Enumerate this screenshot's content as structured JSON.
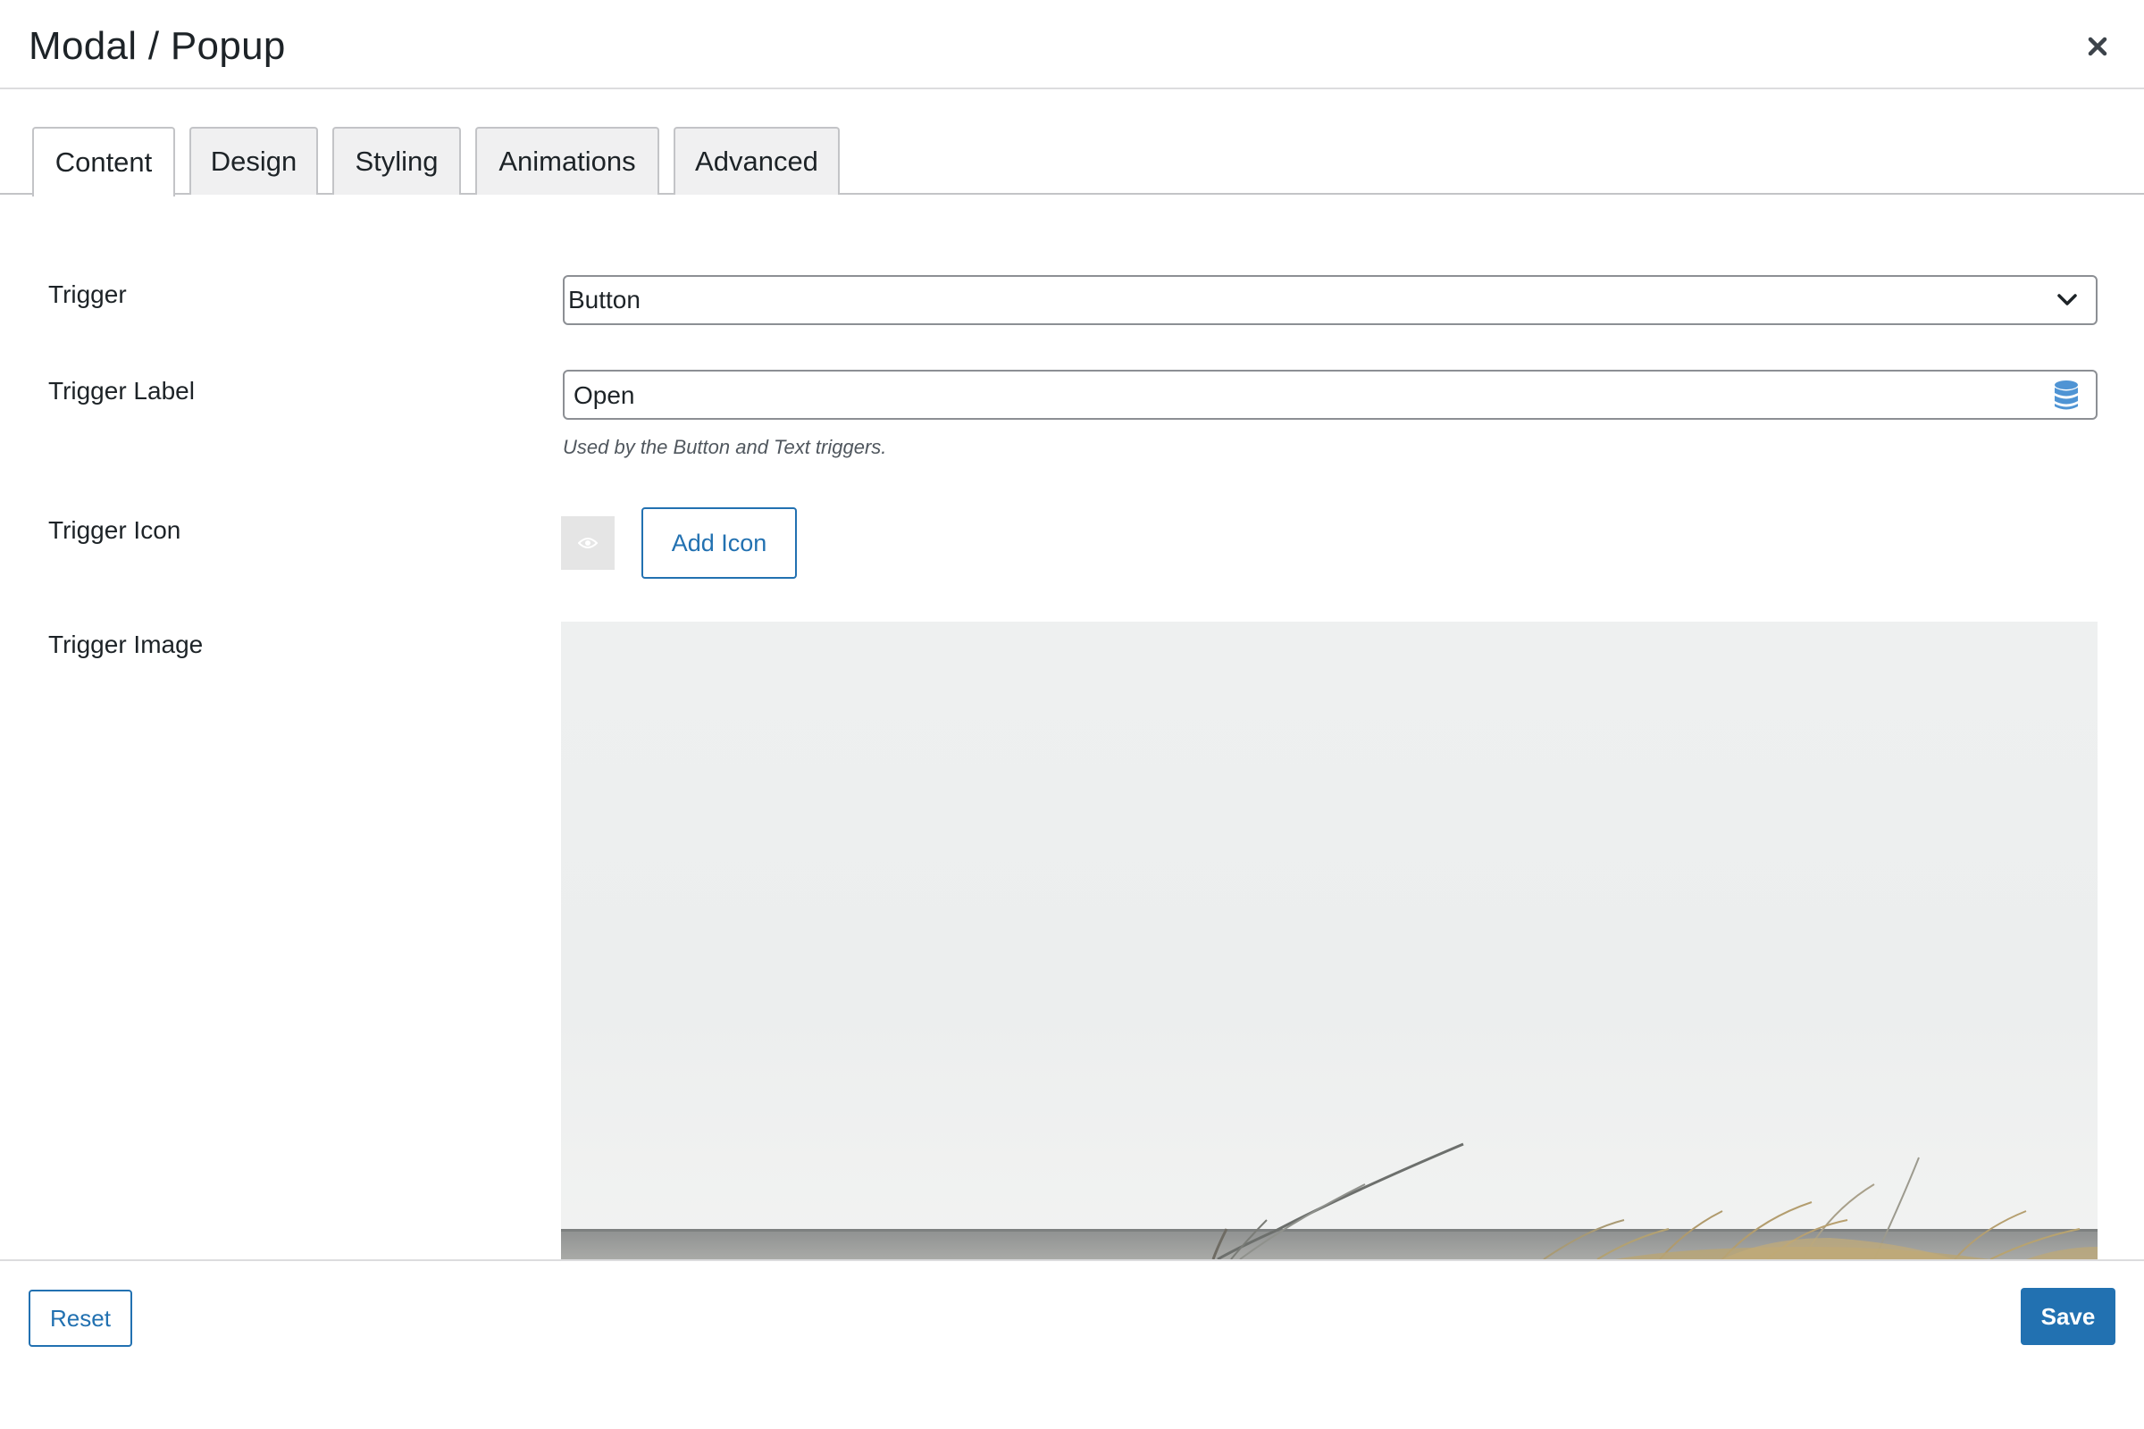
{
  "dialog": {
    "title": "Modal / Popup",
    "close_icon": "close-icon"
  },
  "tabs": [
    {
      "label": "Content",
      "active": true
    },
    {
      "label": "Design",
      "active": false
    },
    {
      "label": "Styling",
      "active": false
    },
    {
      "label": "Animations",
      "active": false
    },
    {
      "label": "Advanced",
      "active": false
    }
  ],
  "fields": {
    "trigger": {
      "label": "Trigger",
      "value": "Button",
      "icon": "chevron-down-icon"
    },
    "trigger_label": {
      "label": "Trigger Label",
      "value": "Open",
      "help": "Used by the Button and Text triggers.",
      "icon": "database-icon"
    },
    "trigger_icon": {
      "label": "Trigger Icon",
      "preview_icon": "eye-icon",
      "button_label": "Add Icon"
    },
    "trigger_image": {
      "label": "Trigger Image"
    }
  },
  "footer": {
    "reset_label": "Reset",
    "save_label": "Save"
  },
  "colors": {
    "accent": "#2271b1",
    "border": "#8c8f94",
    "tab_inactive_bg": "#f0f0f1",
    "text": "#1d2327"
  }
}
